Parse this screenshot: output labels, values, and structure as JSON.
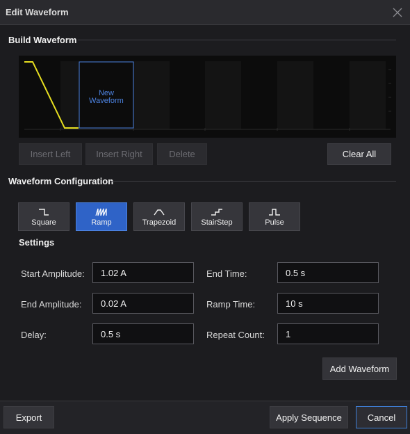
{
  "dialog": {
    "title": "Edit Waveform"
  },
  "build": {
    "section_title": "Build Waveform",
    "preview_label_line1": "New",
    "preview_label_line2": "Waveform",
    "insert_left": "Insert Left",
    "insert_right": "Insert Right",
    "delete": "Delete",
    "clear_all": "Clear All",
    "colors": {
      "trace": "#e8e020",
      "selection": "#4c82e0",
      "label": "#4c82e0"
    }
  },
  "config": {
    "section_title": "Waveform Configuration",
    "types": [
      {
        "label": "Square",
        "icon": "square-wave-icon",
        "active": false
      },
      {
        "label": "Ramp",
        "icon": "ramp-wave-icon",
        "active": true
      },
      {
        "label": "Trapezoid",
        "icon": "trapezoid-wave-icon",
        "active": false
      },
      {
        "label": "StairStep",
        "icon": "stairstep-wave-icon",
        "active": false
      },
      {
        "label": "Pulse",
        "icon": "pulse-wave-icon",
        "active": false
      }
    ],
    "settings_title": "Settings",
    "fields": {
      "start_amplitude": {
        "label": "Start Amplitude:",
        "value": "1.02 A"
      },
      "end_amplitude": {
        "label": "End Amplitude:",
        "value": "0.02 A"
      },
      "delay": {
        "label": "Delay:",
        "value": "0.5 s"
      },
      "end_time": {
        "label": "End Time:",
        "value": "0.5 s"
      },
      "ramp_time": {
        "label": "Ramp Time:",
        "value": "10 s"
      },
      "repeat_count": {
        "label": "Repeat Count:",
        "value": "1"
      }
    },
    "add_waveform": "Add Waveform"
  },
  "footer": {
    "export": "Export",
    "apply_sequence": "Apply Sequence",
    "cancel": "Cancel"
  },
  "accent_color": "#2f63c7"
}
